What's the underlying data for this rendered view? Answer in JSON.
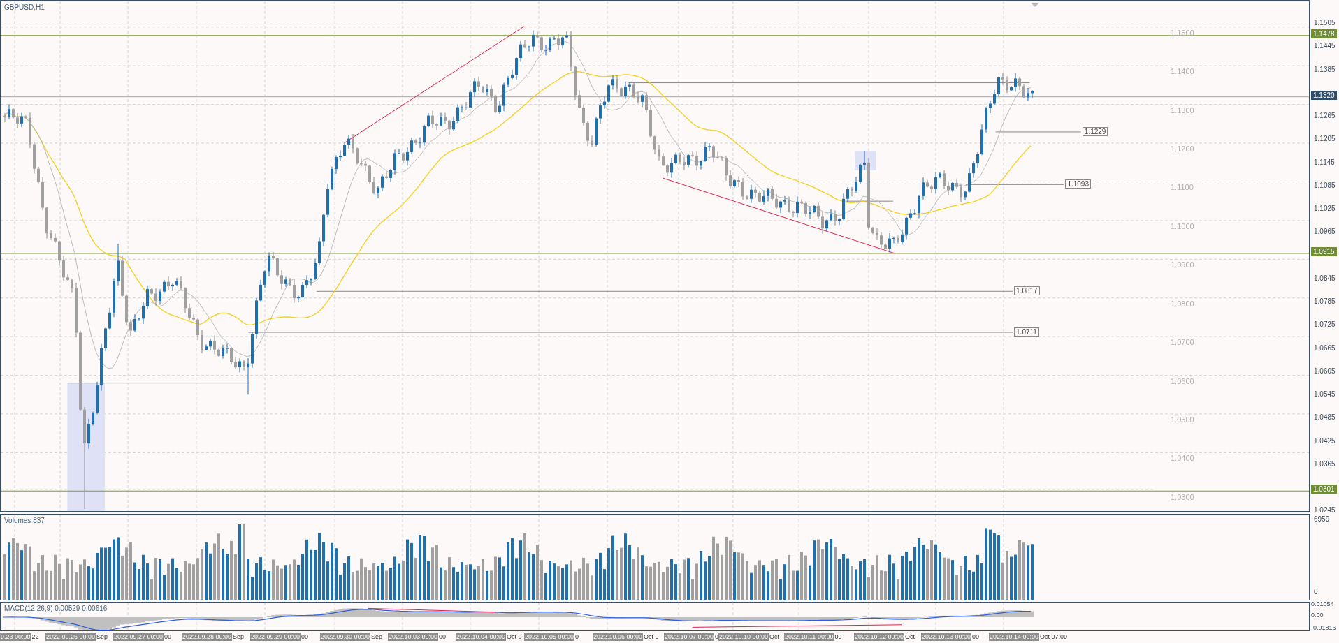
{
  "chart": {
    "title": "GBPUSD,H1",
    "price_axis": [
      "1.1505",
      "1.1445",
      "1.1385",
      "1.1265",
      "1.1205",
      "1.1145",
      "1.1085",
      "1.1025",
      "1.0965",
      "1.0845",
      "1.0785",
      "1.0725",
      "1.0665",
      "1.0605",
      "1.0545",
      "1.0485",
      "1.0425",
      "1.0365",
      "1.0245"
    ],
    "price_tags": [
      {
        "label": "1.1478",
        "kind": "level"
      },
      {
        "label": "1.1320",
        "kind": "bid"
      },
      {
        "label": "1.0915",
        "kind": "level"
      },
      {
        "label": "1.0301",
        "kind": "level"
      }
    ],
    "grid_labels": [
      "1.1500",
      "1.1400",
      "1.1300",
      "1.1200",
      "1.1100",
      "1.1000",
      "1.0900",
      "1.0800",
      "1.0700",
      "1.0600",
      "1.0500",
      "1.0400",
      "1.0300"
    ],
    "line_labels": [
      "1.1229",
      "1.1093",
      "1.0817",
      "1.0711"
    ]
  },
  "volumes": {
    "label": "Volumes 837",
    "axis": [
      "6959",
      "0"
    ]
  },
  "macd": {
    "label": "MACD(12,26,9) 0.00529 0.00616",
    "axis": [
      "0.01054",
      "0.00",
      "-0.01816"
    ]
  },
  "time_axis": [
    {
      "kind": "date",
      "text": "9.23 00:00"
    },
    {
      "kind": "fragment",
      "text": "22"
    },
    {
      "kind": "date",
      "text": "2022.09.26 00:00"
    },
    {
      "kind": "fragment",
      "text": "Sep"
    },
    {
      "kind": "date",
      "text": "2022.09.27 00:00"
    },
    {
      "kind": "fragment",
      "text": "00"
    },
    {
      "kind": "date",
      "text": "2022.09.28 00:00"
    },
    {
      "kind": "fragment",
      "text": "Sep"
    },
    {
      "kind": "date",
      "text": "2022.09.29 00:00"
    },
    {
      "kind": "fragment",
      "text": "00"
    },
    {
      "kind": "date",
      "text": "2022.09.30 00:00"
    },
    {
      "kind": "fragment",
      "text": "Sep"
    },
    {
      "kind": "date",
      "text": "2022.10.03 00:00"
    },
    {
      "kind": "fragment",
      "text": "00"
    },
    {
      "kind": "date",
      "text": "2022.10.04 00:00"
    },
    {
      "kind": "fragment",
      "text": "Oct 0"
    },
    {
      "kind": "date",
      "text": "2022.10.05 00:00"
    },
    {
      "kind": "fragment",
      "text": "0"
    },
    {
      "kind": "date",
      "text": "2022.10.06 00:00"
    },
    {
      "kind": "fragment",
      "text": "Oct 0"
    },
    {
      "kind": "date",
      "text": "2022.10.07 00:00"
    },
    {
      "kind": "fragment",
      "text": "0"
    },
    {
      "kind": "date",
      "text": "2022.10.10 00:00"
    },
    {
      "kind": "fragment",
      "text": "Oct"
    },
    {
      "kind": "date",
      "text": "2022.10.11 00:00"
    },
    {
      "kind": "fragment",
      "text": "00"
    },
    {
      "kind": "date",
      "text": "2022.10.12 00:00"
    },
    {
      "kind": "fragment",
      "text": "Oct"
    },
    {
      "kind": "date",
      "text": "2022.10.13 00:00"
    },
    {
      "kind": "fragment",
      "text": "00"
    },
    {
      "kind": "date",
      "text": "2022.10.14 00:00"
    },
    {
      "kind": "fragment",
      "text": "Oct 07:00"
    }
  ]
}
